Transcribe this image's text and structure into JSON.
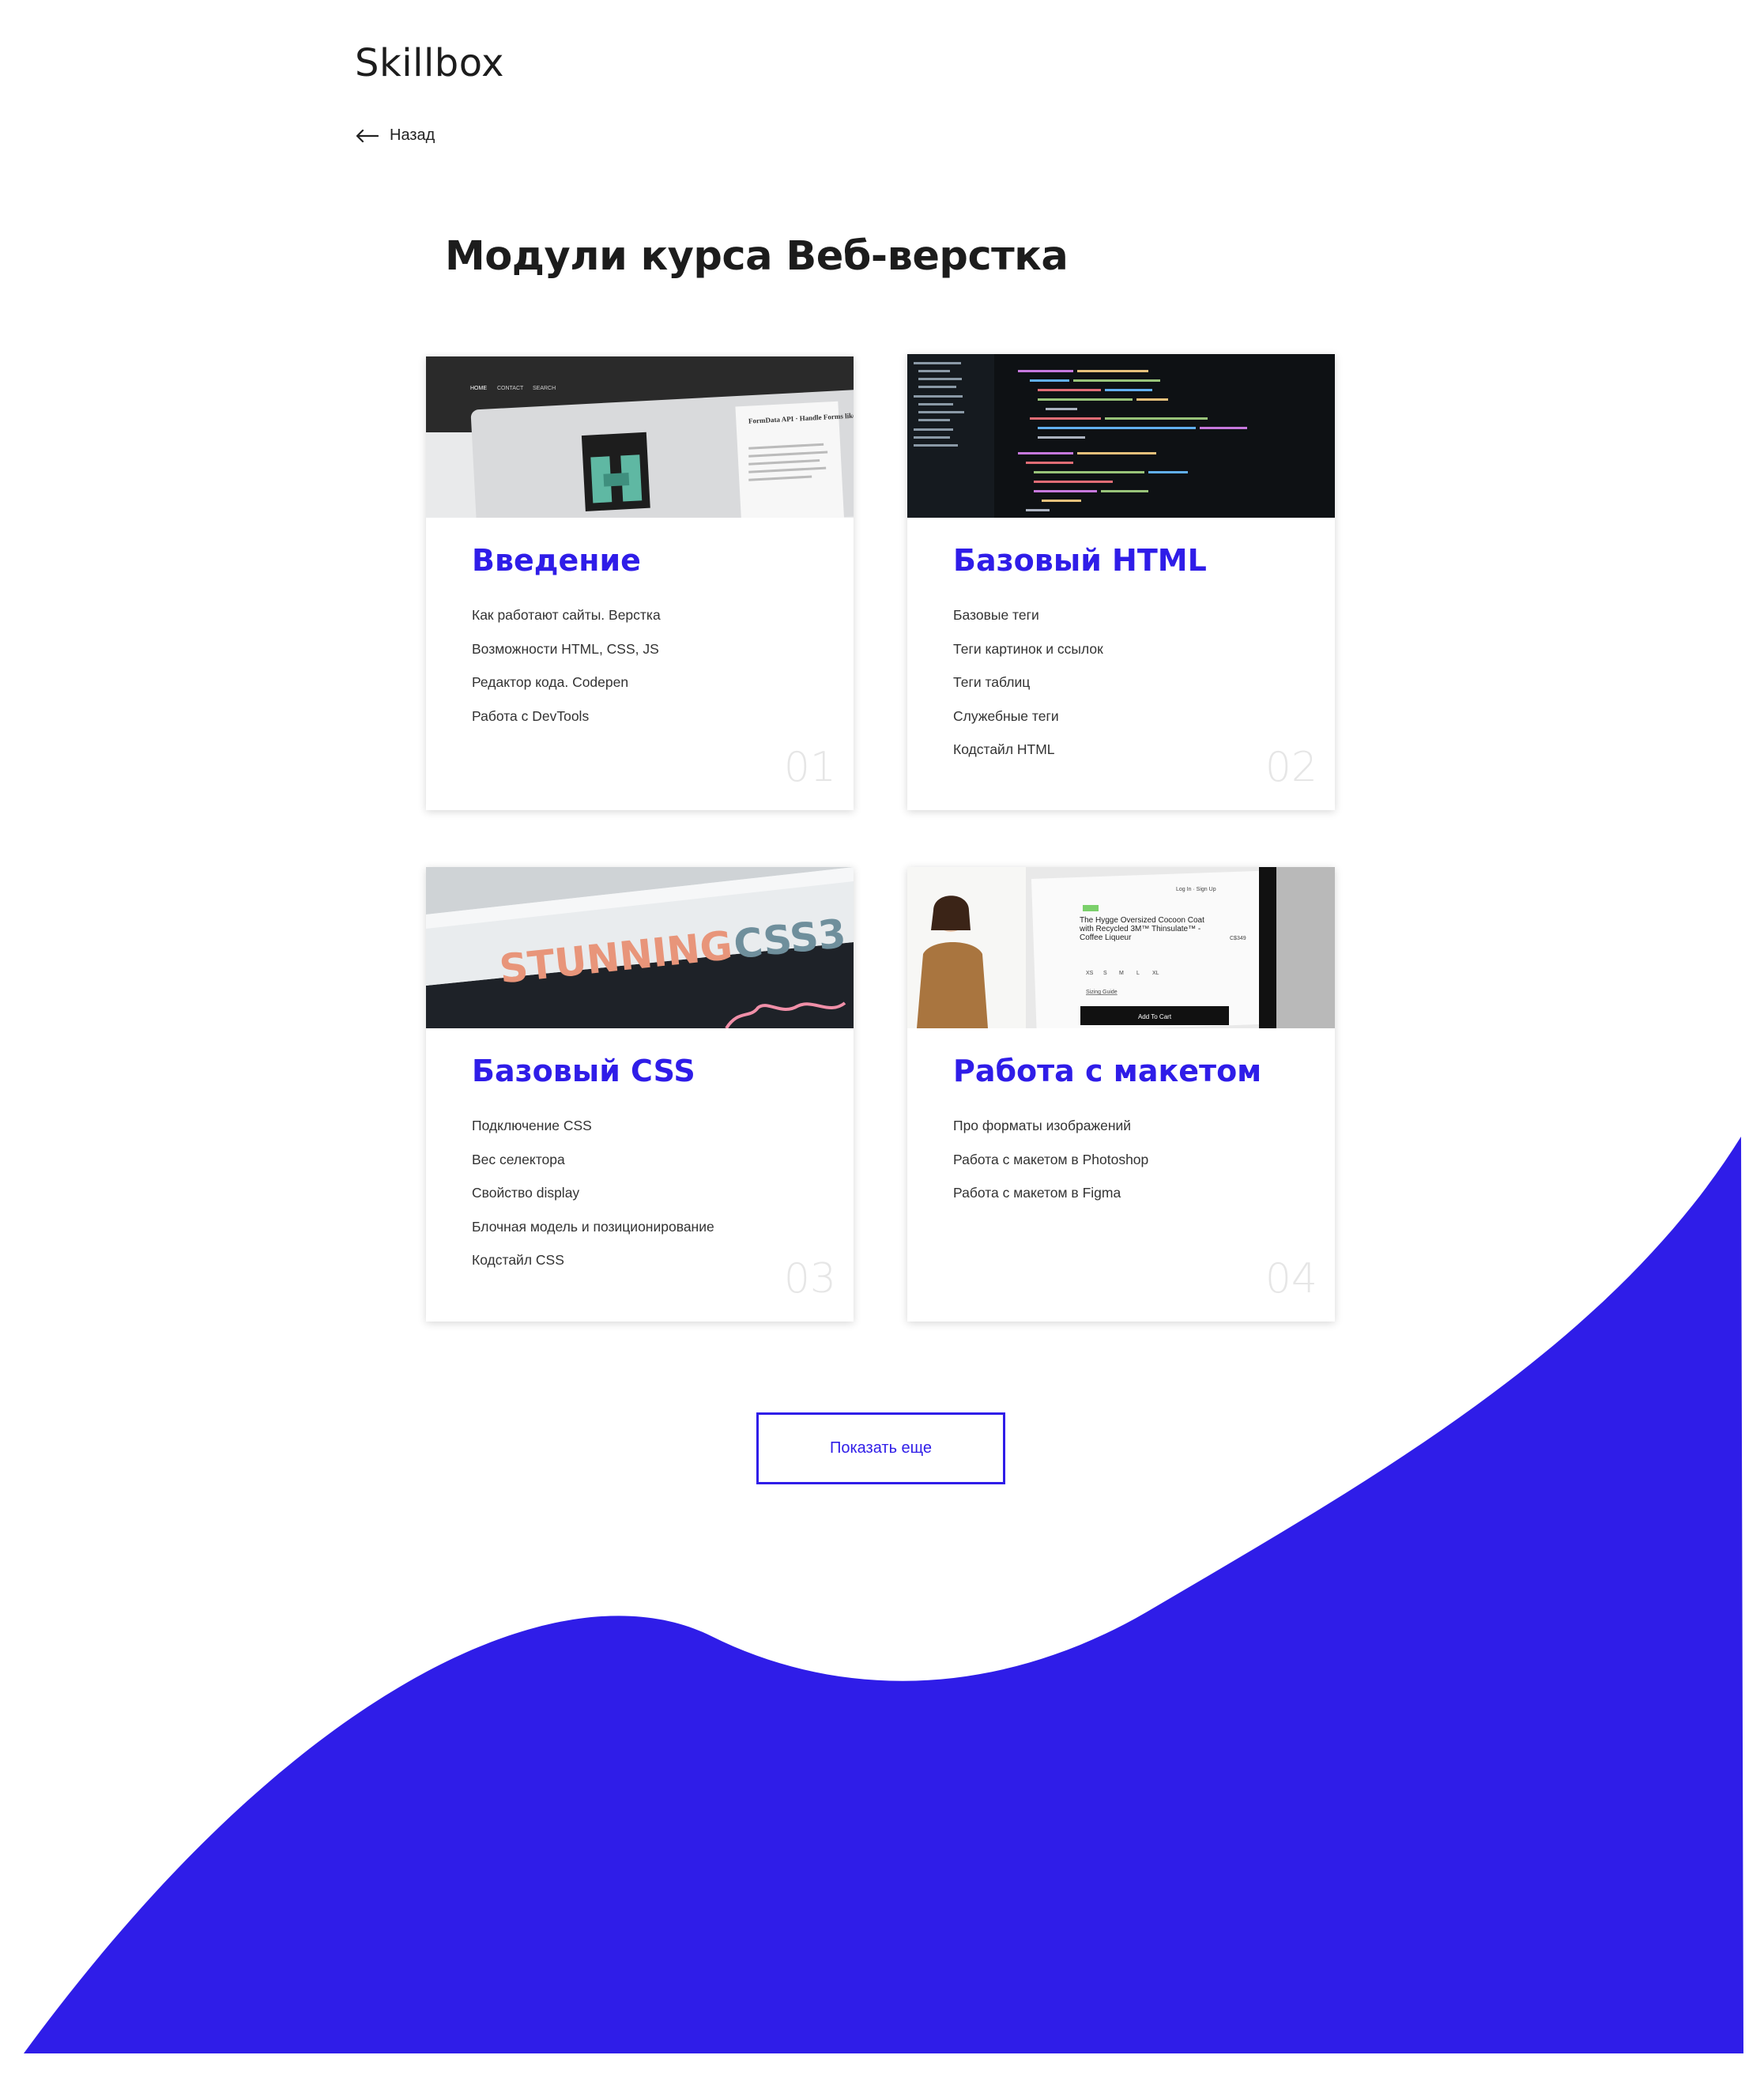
{
  "brand": {
    "logo": "Skillbox",
    "accent": "#2f1de8"
  },
  "nav": {
    "back_label": "Назад"
  },
  "page": {
    "title": "Модули курса Веб-верстка"
  },
  "modules": [
    {
      "title": "Введение",
      "number": "01",
      "topics": [
        "Как работают сайты. Верстка",
        "Возможности HTML, CSS, JS",
        "Редактор кода. Codepen",
        "Работа с DevTools"
      ],
      "thumb": {
        "nav": [
          "HOME",
          "CONTACT",
          "SEARCH"
        ],
        "heading": "FormData API · Handle Forms like Boss 😎"
      }
    },
    {
      "title": "Базовый HTML",
      "number": "02",
      "topics": [
        "Базовые теги",
        "Теги картинок и ссылок",
        "Теги таблиц",
        "Служебные теги",
        "Кодстайл HTML"
      ]
    },
    {
      "title": "Базовый CSS",
      "number": "03",
      "topics": [
        "Подключение CSS",
        "Вес селектора",
        "Свойство display",
        "Блочная модель и позиционирование",
        "Кодстайл CSS"
      ],
      "thumb": {
        "book_word1": "STUNNING",
        "book_word2": "CSS3"
      }
    },
    {
      "title": "Работа с макетом",
      "number": "04",
      "topics": [
        "Про форматы изображений",
        "Работа с макетом в Photoshop",
        "Работа с макетом в Figma"
      ],
      "thumb": {
        "product": "The Hygge Oversized Cocoon Coat with Recycled 3M™ Thinsulate™ - Coffee Liqueur",
        "price": "C$349",
        "sizes": [
          "XS",
          "S",
          "M",
          "L",
          "XL"
        ],
        "size_guide": "Sizing Guide",
        "cart": "Add To Cart",
        "login": "Log In · Sign Up"
      }
    }
  ],
  "actions": {
    "show_more": "Показать еще"
  }
}
